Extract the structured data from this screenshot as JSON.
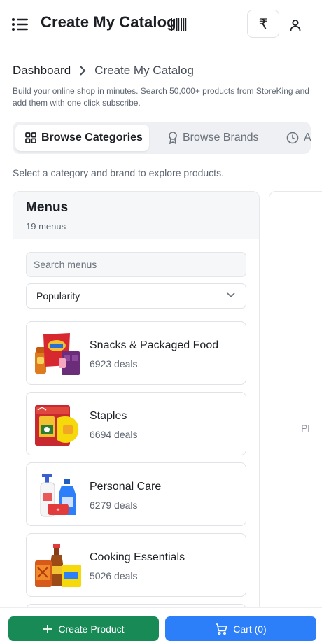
{
  "header": {
    "title": "Create My Catalog",
    "currency_symbol": "₹",
    "menu_icon": "hamburger-icon",
    "barcode_icon": "barcode-icon",
    "user_icon": "user-icon"
  },
  "breadcrumb": {
    "home": "Dashboard",
    "current": "Create My Catalog"
  },
  "description": "Build your online shop in minutes. Search 50,000+ products from StoreKing and add them with one click subscribe.",
  "tabs": [
    {
      "label": "Browse Categories",
      "icon": "grid-icon",
      "active": true
    },
    {
      "label": "Browse Brands",
      "icon": "award-icon",
      "active": false
    },
    {
      "label": "A",
      "icon": "clock-icon",
      "active": false
    }
  ],
  "hint": "Select a category and brand to explore products.",
  "menus": {
    "title": "Menus",
    "count": "19 menus",
    "search_placeholder": "Search menus",
    "sort_value": "Popularity",
    "items": [
      {
        "name": "Snacks & Packaged Food",
        "deals": "6923 deals"
      },
      {
        "name": "Staples",
        "deals": "6694 deals"
      },
      {
        "name": "Personal Care",
        "deals": "6279 deals"
      },
      {
        "name": "Cooking Essentials",
        "deals": "5026 deals"
      }
    ]
  },
  "right_panel": {
    "hint": "Pl"
  },
  "footer": {
    "create_label": "Create Product",
    "cart_label": "Cart (0)"
  },
  "colors": {
    "primary_green": "#178a56",
    "primary_blue": "#2d7ff9"
  }
}
